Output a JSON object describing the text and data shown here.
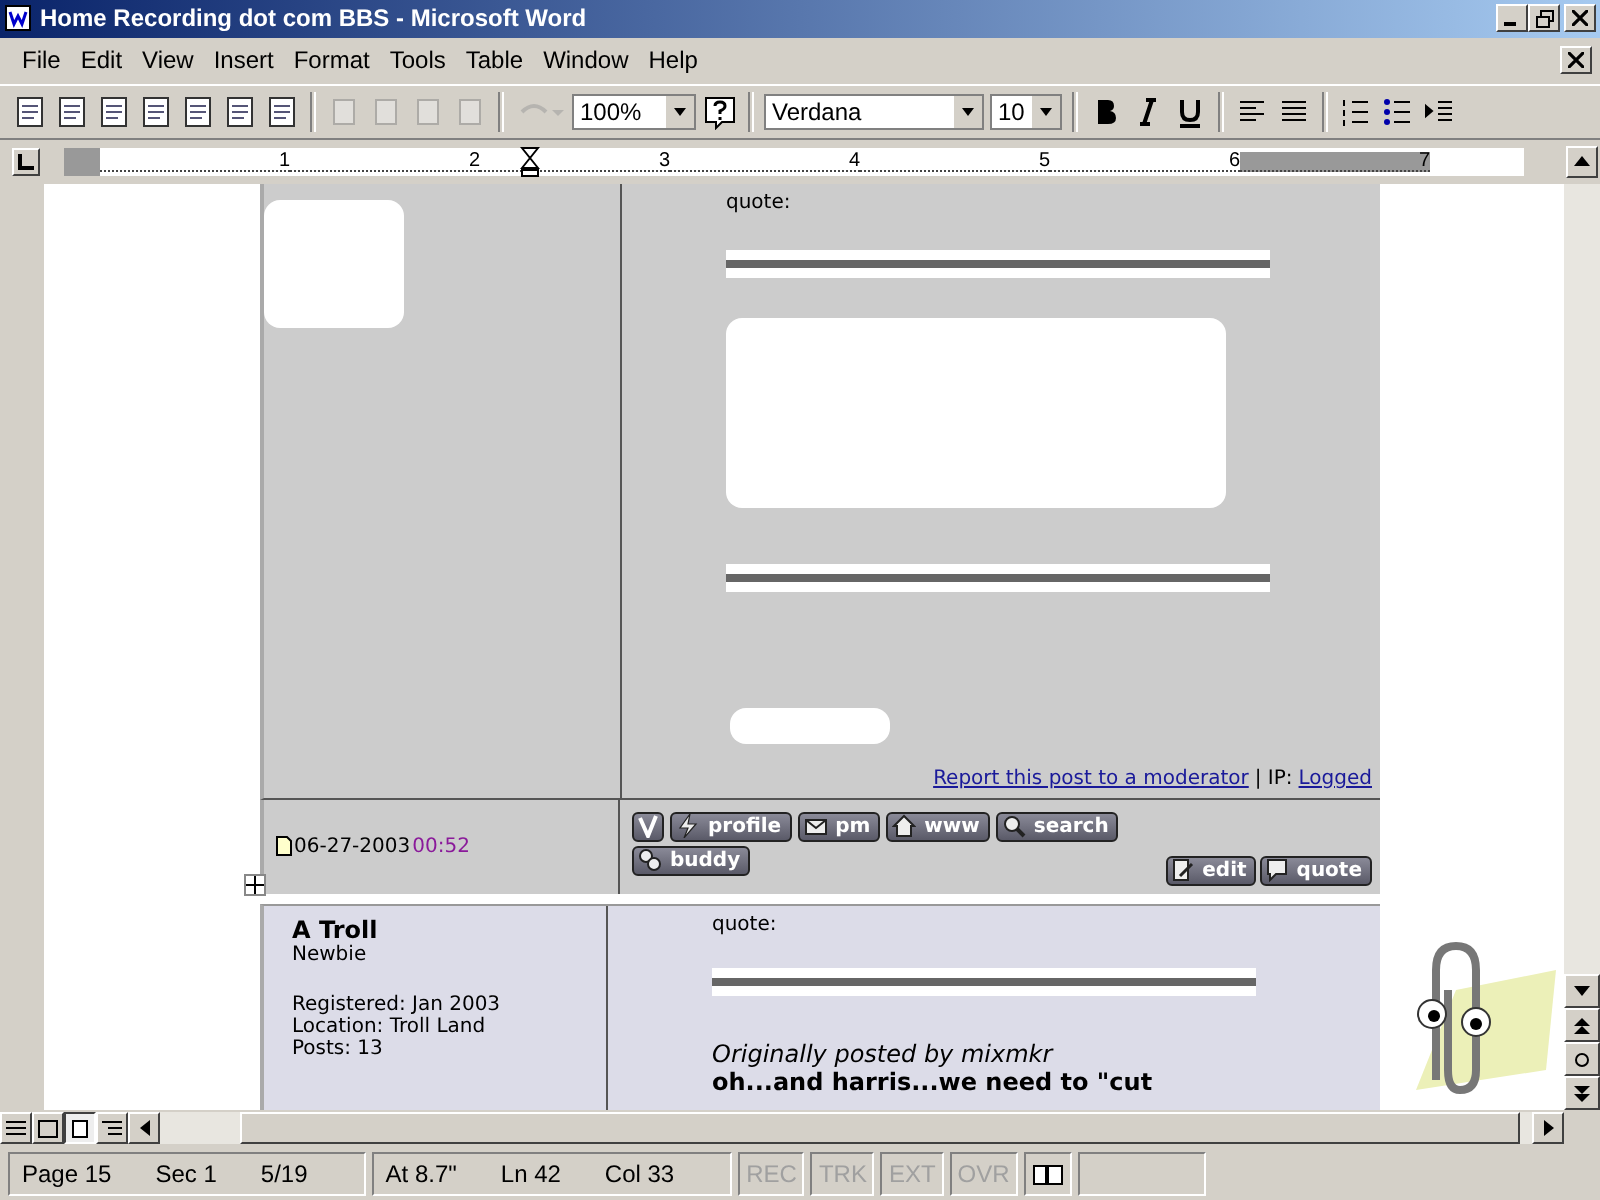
{
  "window": {
    "title": "Home Recording dot com BBS - Microsoft Word"
  },
  "menu": [
    "File",
    "Edit",
    "View",
    "Insert",
    "Format",
    "Tools",
    "Table",
    "Window",
    "Help"
  ],
  "toolbar": {
    "zoom": "100%",
    "font": "Verdana",
    "size": "10"
  },
  "ruler": [
    "1",
    "2",
    "3",
    "4",
    "5",
    "6",
    "7"
  ],
  "post1": {
    "quote_label": "quote:",
    "report_link": "Report this post to a moderator",
    "ip_label": "| IP:",
    "ip_value": "Logged",
    "date": "06-27-2003",
    "time": "00:52",
    "buttons": [
      {
        "kind": "profile",
        "label": "profile"
      },
      {
        "kind": "pm",
        "label": "pm"
      },
      {
        "kind": "www",
        "label": "www"
      },
      {
        "kind": "search",
        "label": "search"
      },
      {
        "kind": "buddy",
        "label": "buddy"
      }
    ],
    "actions": [
      {
        "kind": "edit",
        "label": "edit"
      },
      {
        "kind": "quote",
        "label": "quote"
      }
    ]
  },
  "post2": {
    "author": "A Troll",
    "rank": "Newbie",
    "details": [
      "Registered: Jan 2003",
      "Location: Troll Land",
      "Posts: 13"
    ],
    "quote_label": "quote:",
    "quote_author": "Originally posted by mixmkr",
    "quote_text": "oh...and harris...we need to \"cut"
  },
  "status_bar": {
    "groups": [
      [
        "Page 15",
        "Sec 1",
        "5/19"
      ],
      [
        "At 8.7\"",
        "Ln 42",
        "Col 33"
      ]
    ],
    "modes": [
      {
        "label": "REC",
        "disabled": true
      },
      {
        "label": "TRK",
        "disabled": true
      },
      {
        "label": "EXT",
        "disabled": true
      },
      {
        "label": "OVR",
        "disabled": true
      }
    ]
  }
}
